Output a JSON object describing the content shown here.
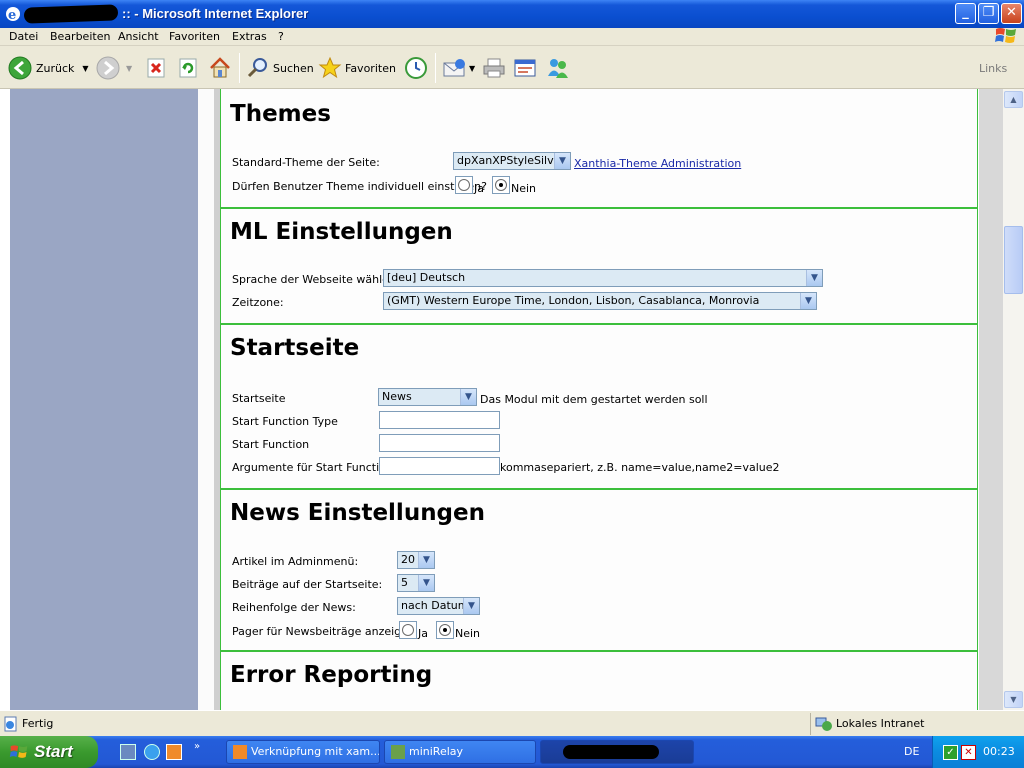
{
  "window": {
    "title": ":: - Microsoft Internet Explorer",
    "min_label": "_",
    "max_label": "❐",
    "close_label": "✕"
  },
  "menu": {
    "items": [
      "Datei",
      "Bearbeiten",
      "Ansicht",
      "Favoriten",
      "Extras",
      "?"
    ]
  },
  "toolbar": {
    "back_label": "Zurück",
    "search_label": "Suchen",
    "favorites_label": "Favoriten",
    "links_label": "Links"
  },
  "themes": {
    "heading": "Themes",
    "standard_label": "Standard-Theme der Seite:",
    "standard_value": "dpXanXPStyleSilver",
    "admin_link": "Xanthia-Theme Administration",
    "individual_label": "Dürfen Benutzer Theme individuell einstellen?",
    "yes": "Ja",
    "no": "Nein",
    "selected": "Nein"
  },
  "ml": {
    "heading": "ML Einstellungen",
    "language_label": "Sprache der Webseite wählen:",
    "language_value": "[deu] Deutsch",
    "timezone_label": "Zeitzone:",
    "timezone_value": "(GMT) Western Europe Time, London, Lisbon, Casablanca, Monrovia"
  },
  "startseite": {
    "heading": "Startseite",
    "start_label": "Startseite",
    "start_value": "News",
    "start_hint": "Das Modul mit dem gestartet werden soll",
    "function_type_label": "Start Function Type",
    "function_type_value": "",
    "function_label": "Start Function",
    "function_value": "",
    "args_label": "Argumente für Start Function",
    "args_value": "",
    "args_hint": "kommasepariert, z.B. name=value,name2=value2"
  },
  "news": {
    "heading": "News Einstellungen",
    "articles_label": "Artikel im Adminmenü:",
    "articles_value": "20",
    "posts_label": "Beiträge auf der Startseite:",
    "posts_value": "5",
    "order_label": "Reihenfolge der News:",
    "order_value": "nach Datum",
    "pager_label": "Pager für Newsbeiträge anzeigen",
    "yes": "Ja",
    "no": "Nein",
    "selected": "Nein"
  },
  "error": {
    "heading": "Error Reporting"
  },
  "status": {
    "text": "Fertig",
    "zone": "Lokales Intranet"
  },
  "taskbar": {
    "start_label": "Start",
    "tasks": [
      "Verknüpfung mit xam...",
      "miniRelay"
    ],
    "language": "DE",
    "clock": "00:23"
  },
  "colors": {
    "section_border": "#3cbf3c",
    "sidebar": "#9aa6c4",
    "link": "#1a2aa8"
  }
}
